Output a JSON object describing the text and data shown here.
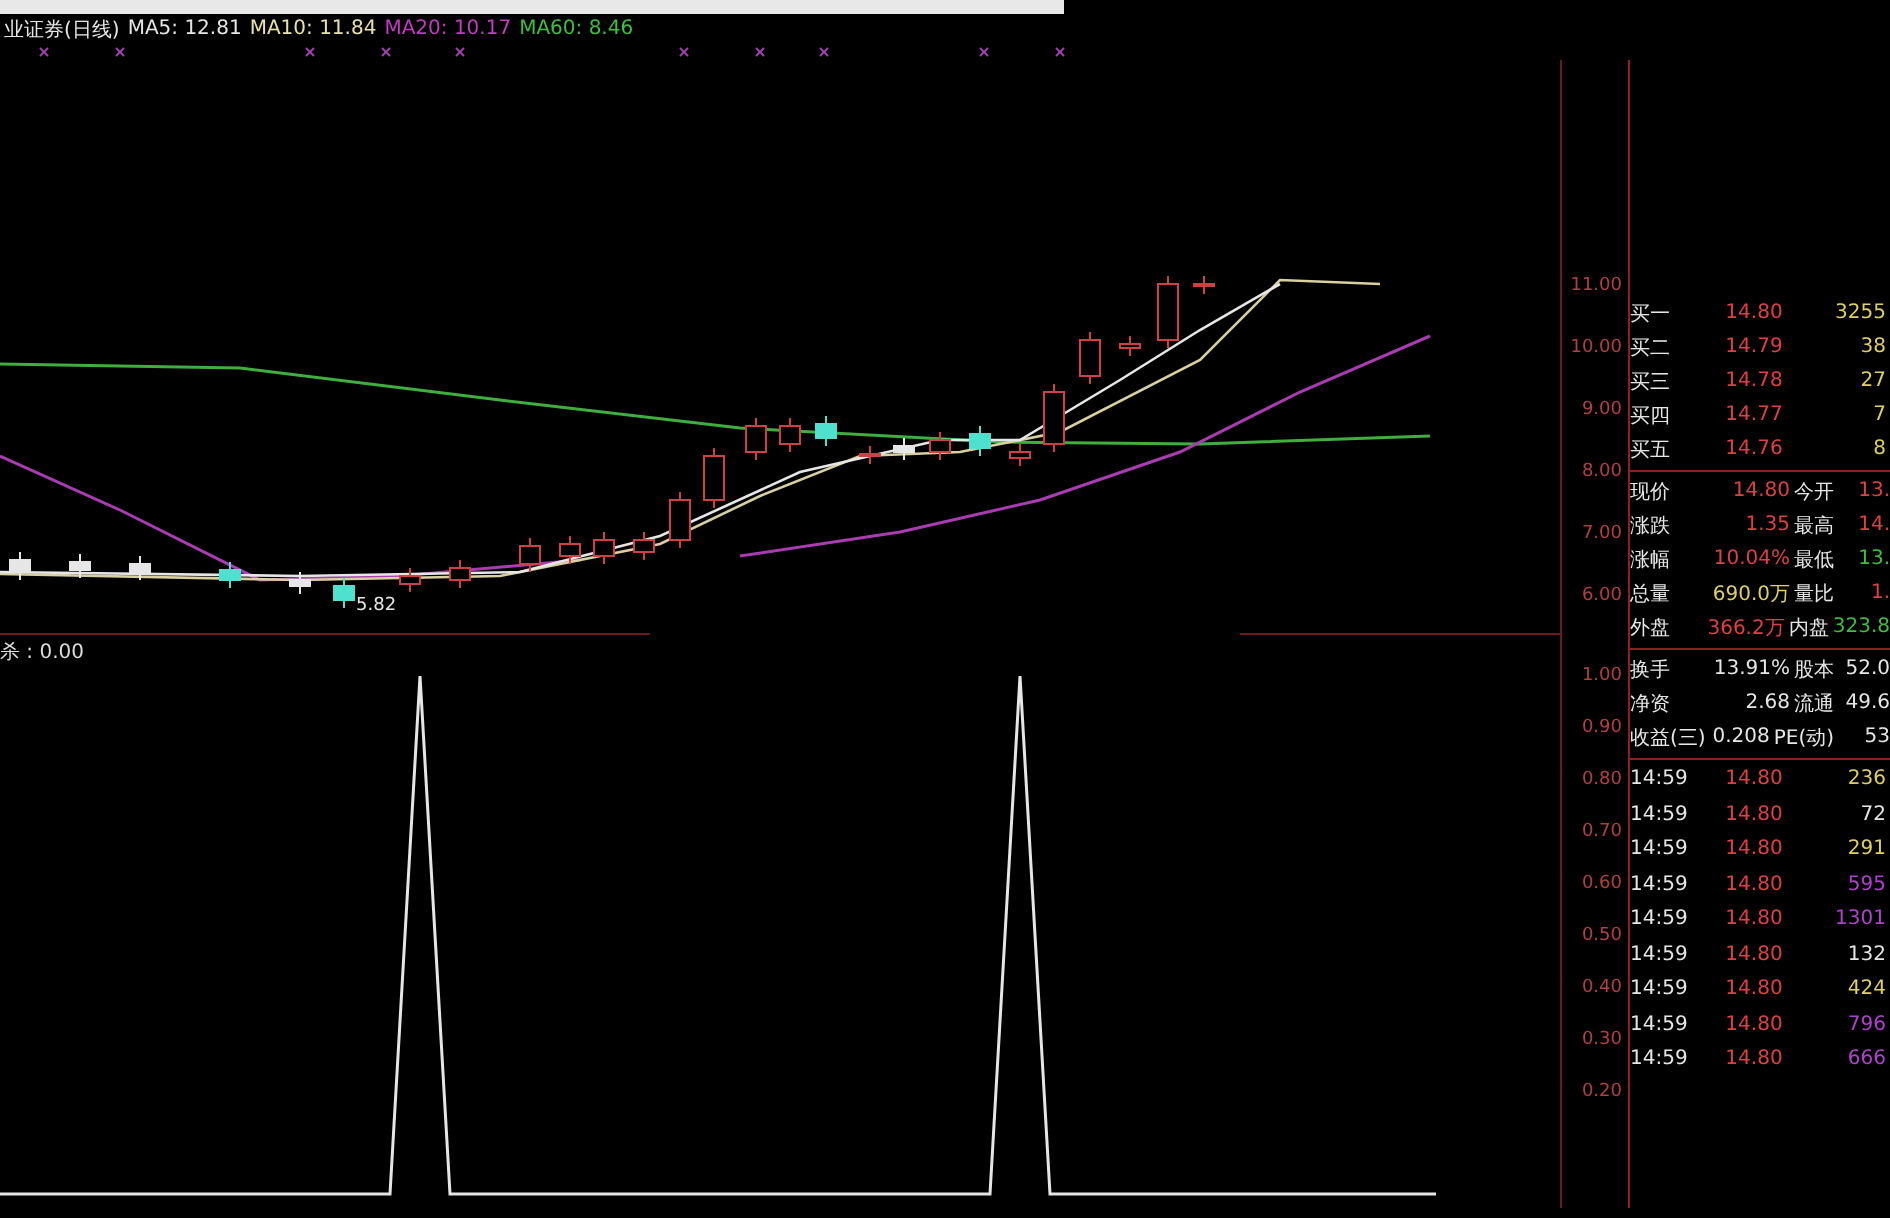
{
  "title": {
    "name": "业证券(日线)",
    "ma": [
      {
        "label": "MA5: 12.81",
        "color": "#e6e6e6"
      },
      {
        "label": "MA10: 11.84",
        "color": "#e8e2a8"
      },
      {
        "label": "MA20: 10.17",
        "color": "#c23bc2"
      },
      {
        "label": "MA60: 8.46",
        "color": "#3fbf3f"
      }
    ]
  },
  "price_chart": {
    "low_label": "5.82",
    "axis_labels": [
      "11.00",
      "10.00",
      "9.00",
      "8.00",
      "7.00",
      "6.00"
    ]
  },
  "indicator": {
    "title": "杀 : 0.00",
    "axis_labels": [
      "1.00",
      "0.90",
      "0.80",
      "0.70",
      "0.60",
      "0.50",
      "0.40",
      "0.30",
      "0.20"
    ]
  },
  "order_book": [
    {
      "label": "买一",
      "price": "14.80",
      "volume": "3255"
    },
    {
      "label": "买二",
      "price": "14.79",
      "volume": "38"
    },
    {
      "label": "买三",
      "price": "14.78",
      "volume": "27"
    },
    {
      "label": "买四",
      "price": "14.77",
      "volume": "7"
    },
    {
      "label": "买五",
      "price": "14.76",
      "volume": "8"
    }
  ],
  "quote": [
    {
      "left": {
        "label": "现价",
        "value": "14.80",
        "color": "#e04040"
      },
      "right": {
        "label": "今开",
        "value": "13.",
        "color": "#e04040"
      }
    },
    {
      "left": {
        "label": "涨跌",
        "value": "1.35",
        "color": "#e04040"
      },
      "right": {
        "label": "最高",
        "value": "14.",
        "color": "#e04040"
      }
    },
    {
      "left": {
        "label": "涨幅",
        "value": "10.04%",
        "color": "#e04040"
      },
      "right": {
        "label": "最低",
        "value": "13.",
        "color": "#3fbf3f"
      }
    },
    {
      "left": {
        "label": "总量",
        "value": "690.0万",
        "color": "#e0d060"
      },
      "right": {
        "label": "量比",
        "value": "1.",
        "color": "#e04040"
      }
    },
    {
      "left": {
        "label": "外盘",
        "value": "366.2万",
        "color": "#e04040"
      },
      "right": {
        "label": "内盘",
        "value": "323.8",
        "color": "#3fbf3f"
      }
    }
  ],
  "stats": [
    {
      "label": "换手",
      "value": "13.91%",
      "label2": "股本",
      "value2": "52.0"
    },
    {
      "label": "净资",
      "value": "2.68",
      "label2": "流通",
      "value2": "49.6"
    },
    {
      "label": "收益(三)",
      "value": "0.208",
      "label2": "PE(动)",
      "value2": "53"
    }
  ],
  "ticks": [
    {
      "time": "14:59",
      "price": "14.80",
      "volume": "236",
      "color": "#e0d060"
    },
    {
      "time": "14:59",
      "price": "14.80",
      "volume": "72",
      "color": "#e6e6e6"
    },
    {
      "time": "14:59",
      "price": "14.80",
      "volume": "291",
      "color": "#e0d060"
    },
    {
      "time": "14:59",
      "price": "14.80",
      "volume": "595",
      "color": "#b040d0"
    },
    {
      "time": "14:59",
      "price": "14.80",
      "volume": "1301",
      "color": "#b040d0"
    },
    {
      "time": "14:59",
      "price": "14.80",
      "volume": "132",
      "color": "#e6e6e6"
    },
    {
      "time": "14:59",
      "price": "14.80",
      "volume": "424",
      "color": "#e0d060"
    },
    {
      "time": "14:59",
      "price": "14.80",
      "volume": "796",
      "color": "#b040d0"
    },
    {
      "time": "14:59",
      "price": "14.80",
      "volume": "666",
      "color": "#b040d0"
    }
  ]
}
